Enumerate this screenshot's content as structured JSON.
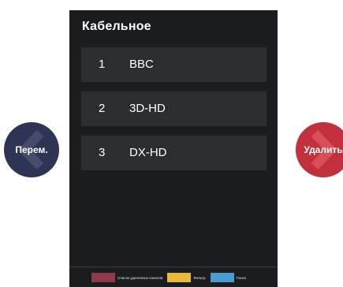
{
  "panel": {
    "title": "Кабельное",
    "channels": [
      {
        "number": "1",
        "name": "BBC"
      },
      {
        "number": "2",
        "name": "3D-HD"
      },
      {
        "number": "3",
        "name": "DX-HD"
      }
    ]
  },
  "side_buttons": {
    "move_label": "Перем.",
    "delete_label": "Удалить",
    "move_color": "#2e3453",
    "delete_color": "#c2303d",
    "move_icon": "chevron-left-icon",
    "delete_icon": "chevron-right-icon"
  },
  "legend": [
    {
      "color": "#8e3a4a",
      "label": "Список удаленных каналов"
    },
    {
      "color": "#e8b93a",
      "label": "Фильтр"
    },
    {
      "color": "#4a9bd1",
      "label": "Поиск"
    }
  ]
}
